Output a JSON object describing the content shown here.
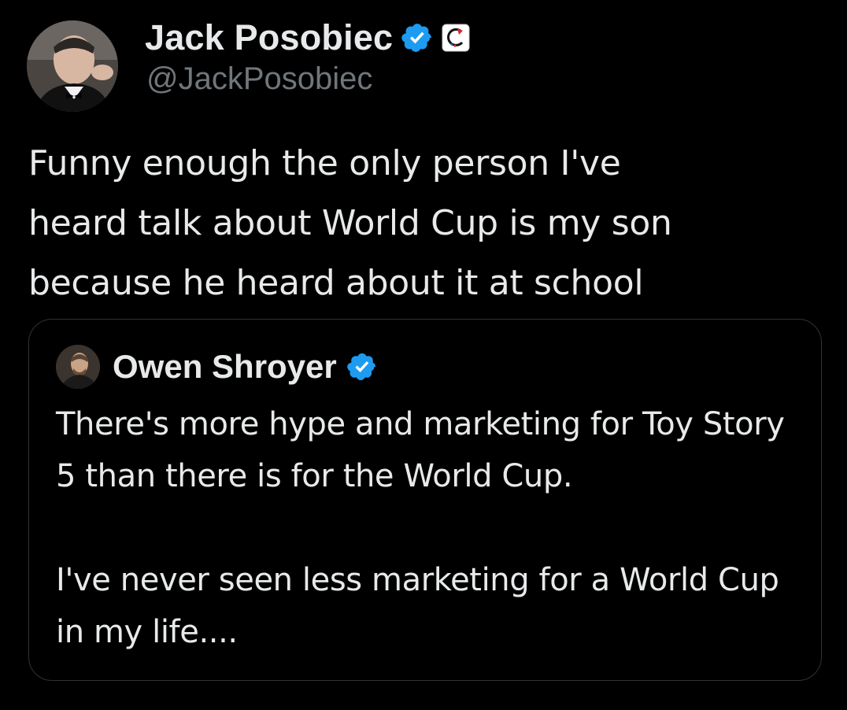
{
  "author": {
    "display_name": "Jack Posobiec",
    "handle": "@JackPosobiec",
    "avatar_icon": "profile-photo",
    "verified_icon": "verified-badge-icon",
    "affiliate_icon": "affiliate-badge-icon"
  },
  "tweet": {
    "text": "Funny enough the only person I've\nheard talk about World Cup is my son\nbecause he heard about it at school"
  },
  "quoted_tweet": {
    "display_name": "Owen Shroyer",
    "avatar_icon": "profile-photo",
    "verified_icon": "verified-badge-icon",
    "paragraphs": [
      "There's more hype and marketing for Toy Story 5 than there is for the World Cup.",
      "I've never seen less marketing for a World Cup in my life...."
    ]
  },
  "colors": {
    "background": "#000000",
    "text_primary": "#e7e9ea",
    "text_secondary": "#71767b",
    "verified_blue": "#1d9bf0",
    "card_border": "#2f3336"
  }
}
